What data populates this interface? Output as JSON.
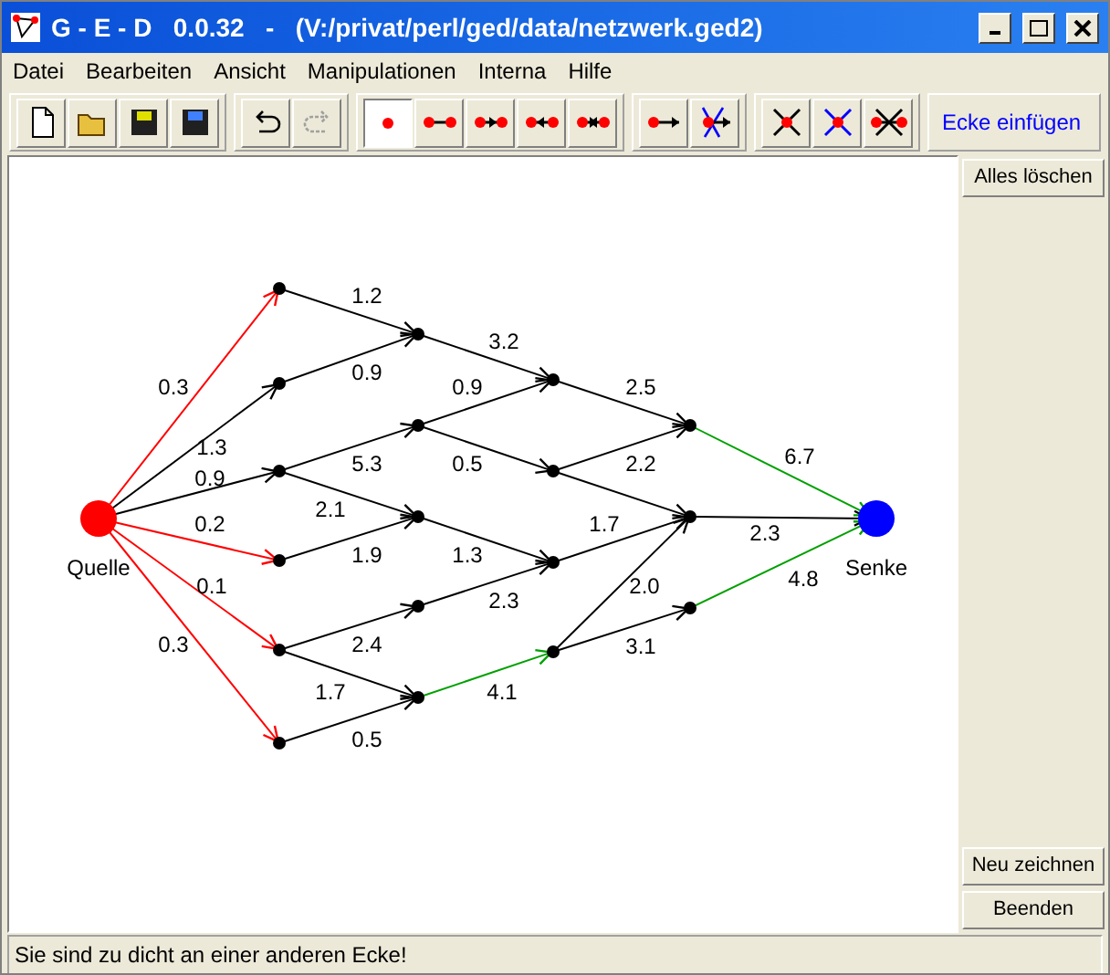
{
  "window": {
    "title": "G - E - D   0.0.32   -   (V:/privat/perl/ged/data/netzwerk.ged2)"
  },
  "menu": [
    "Datei",
    "Bearbeiten",
    "Ansicht",
    "Manipulationen",
    "Interna",
    "Hilfe"
  ],
  "toolbar": {
    "file_buttons": [
      {
        "kind": "new"
      },
      {
        "kind": "open"
      },
      {
        "kind": "save"
      },
      {
        "kind": "saveas"
      }
    ],
    "edit_buttons": [
      {
        "kind": "undo",
        "disabled": false
      },
      {
        "kind": "redo",
        "disabled": true
      }
    ],
    "mode_groups": [
      [
        {
          "kind": "vertex",
          "selected": true
        },
        {
          "kind": "edge",
          "selected": false
        },
        {
          "kind": "arrow-right",
          "selected": false
        },
        {
          "kind": "arrow-left",
          "selected": false
        },
        {
          "kind": "arrow-both",
          "selected": false
        }
      ],
      [
        {
          "kind": "directed",
          "selected": false
        },
        {
          "kind": "redirect",
          "selected": false
        }
      ],
      [
        {
          "kind": "delete-vertex",
          "selected": false
        },
        {
          "kind": "delete-vertex-blue",
          "selected": false
        },
        {
          "kind": "delete-edge",
          "selected": false
        }
      ]
    ],
    "mode_label": "Ecke einfügen"
  },
  "graph": {
    "nodes": [
      {
        "label": "Quelle",
        "color": "#ff0000"
      },
      {
        "color": "#000000"
      },
      {
        "color": "#000000"
      },
      {
        "color": "#000000"
      },
      {
        "color": "#000000"
      },
      {
        "color": "#000000"
      },
      {
        "color": "#000000"
      },
      {
        "color": "#000000"
      },
      {
        "color": "#000000"
      },
      {
        "color": "#000000"
      },
      {
        "color": "#000000"
      },
      {
        "color": "#000000"
      },
      {
        "color": "#000000"
      },
      {
        "color": "#000000"
      },
      {
        "color": "#000000"
      },
      {
        "color": "#000000"
      },
      {
        "color": "#000000"
      },
      {
        "color": "#000000"
      },
      {
        "color": "#000000"
      },
      {
        "label": "Senke",
        "color": "#0000ff"
      }
    ],
    "edges": [
      {
        "label": "0.3",
        "color": "#ff0000"
      },
      {
        "label": "1.3",
        "color": "#000000"
      },
      {
        "label": "0.9",
        "color": "#000000"
      },
      {
        "label": "0.2",
        "color": "#ff0000"
      },
      {
        "label": "0.1",
        "color": "#ff0000"
      },
      {
        "label": "0.3",
        "color": "#ff0000"
      },
      {
        "label": "1.2",
        "color": "#000000"
      },
      {
        "label": "0.9",
        "color": "#000000"
      },
      {
        "label": "5.3",
        "color": "#000000"
      },
      {
        "label": "2.1",
        "color": "#000000"
      },
      {
        "label": "1.9",
        "color": "#000000"
      },
      {
        "label": "2.4",
        "color": "#000000"
      },
      {
        "label": "1.7",
        "color": "#000000"
      },
      {
        "label": "0.5",
        "color": "#000000"
      },
      {
        "label": "3.2",
        "color": "#000000"
      },
      {
        "label": "0.9",
        "color": "#000000"
      },
      {
        "label": "0.5",
        "color": "#000000"
      },
      {
        "label": "1.3",
        "color": "#000000"
      },
      {
        "label": "2.3",
        "color": "#000000"
      },
      {
        "label": "4.1",
        "color": "#00a000"
      },
      {
        "label": "2.5",
        "color": "#000000"
      },
      {
        "label": "2.2",
        "color": "#000000"
      },
      {
        "color": "#000000"
      },
      {
        "label": "1.7",
        "color": "#000000"
      },
      {
        "label": "2.0",
        "color": "#000000"
      },
      {
        "label": "3.1",
        "color": "#000000"
      },
      {
        "label": "6.7",
        "color": "#00a000"
      },
      {
        "label": "2.3",
        "color": "#000000"
      },
      {
        "label": "4.8",
        "color": "#00a000"
      }
    ]
  },
  "side_buttons_top": [
    "Alles löschen"
  ],
  "side_buttons_bottom": [
    "Neu zeichnen",
    "Beenden"
  ],
  "status_bar": "Sie sind zu dicht an einer anderen Ecke!"
}
